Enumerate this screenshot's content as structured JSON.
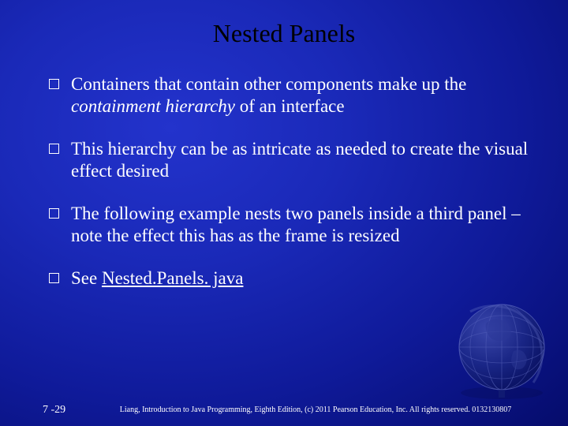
{
  "title": "Nested Panels",
  "bullets": [
    {
      "pre": "Containers that contain other components make up the ",
      "em": "containment hierarchy",
      "post": " of an interface"
    },
    {
      "pre": "This hierarchy can be as intricate as needed to create the visual effect desired",
      "em": "",
      "post": ""
    },
    {
      "pre": "The following example nests two panels inside a third panel – note the effect this has as the frame is resized",
      "em": "",
      "post": ""
    },
    {
      "pre": "See ",
      "link": "Nested.Panels. java",
      "post": ""
    }
  ],
  "footer": {
    "page": "7 -29",
    "copyright": "Liang, Introduction to Java Programming, Eighth Edition, (c) 2011 Pearson Education, Inc. All rights reserved. 0132130807"
  }
}
